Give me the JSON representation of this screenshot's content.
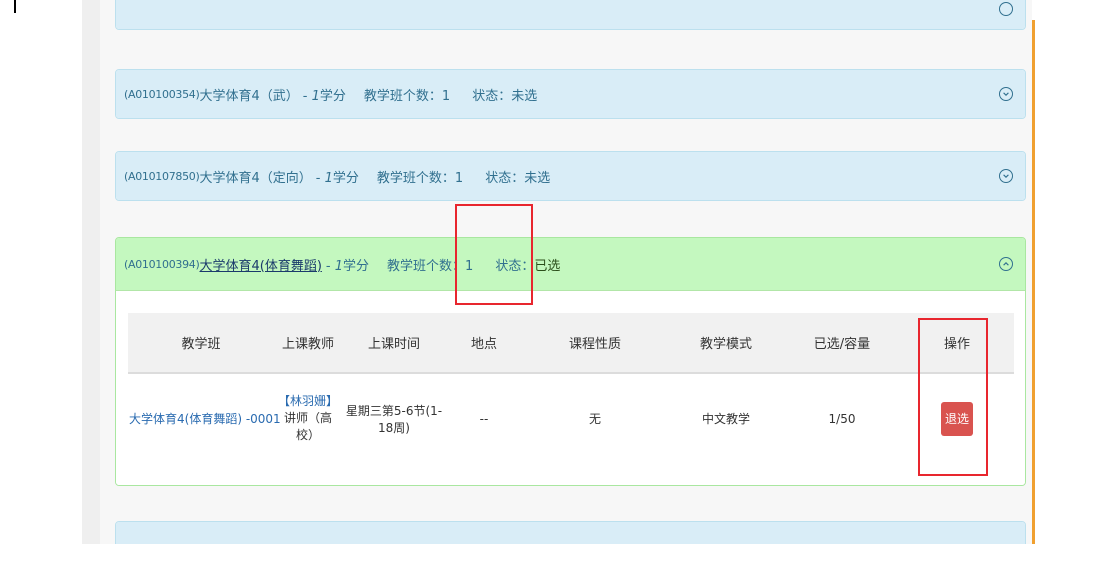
{
  "courses": [
    {
      "code": "(A010100354)",
      "name": "大学体育4（武）",
      "credit_sep": " - ",
      "credit_num": "1",
      "credit_unit": "学分",
      "class_count": "教学班个数：1",
      "status_label": "状态：",
      "status_value": "未选"
    },
    {
      "code": "(A010107850)",
      "name": "大学体育4（定向）",
      "credit_sep": " - ",
      "credit_num": "1",
      "credit_unit": "学分",
      "class_count": "教学班个数：1",
      "status_label": "状态：",
      "status_value": "未选"
    },
    {
      "code": "(A010100394)",
      "name": "大学体育4(体育舞蹈)",
      "credit_sep": " - ",
      "credit_num": "1",
      "credit_unit": "学分",
      "class_count": "教学班个数：1",
      "status_label": "状态：",
      "status_value": "已选"
    }
  ],
  "table": {
    "headers": [
      "教学班",
      "上课教师",
      "上课时间",
      "地点",
      "课程性质",
      "教学模式",
      "已选/容量",
      "操作"
    ],
    "row": {
      "class_name": "大学体育4(体育舞蹈) -0001",
      "teacher_name": "【林羽姗】",
      "teacher_title": "讲师（高校）",
      "time": "星期三第5-6节(1-18周)",
      "location": "--",
      "nature": "无",
      "mode": "中文教学",
      "capacity": "1/50",
      "action": "退选"
    }
  },
  "colors": {
    "panel_header": "#d9edf7",
    "selected_header": "#c4f8bf",
    "drop_button": "#d9534f",
    "annotation": "#e8262e",
    "accent_rail": "#f0a030"
  }
}
